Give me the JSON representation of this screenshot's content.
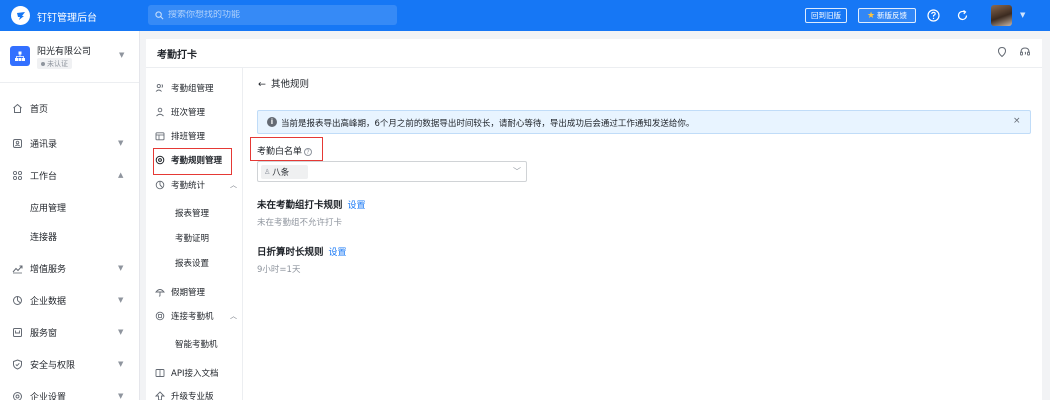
{
  "topbar": {
    "app_title": "钉钉管理后台",
    "search_placeholder": "搜索你想找的功能",
    "old_version_label": "回到旧版",
    "feedback_label": "新版反馈"
  },
  "org": {
    "name": "阳光有限公司",
    "status": "未认证"
  },
  "left_nav": {
    "home": "首页",
    "contacts": "通讯录",
    "workbench": "工作台",
    "app_manage": "应用管理",
    "connector": "连接器",
    "value_added": "增值服务",
    "enterprise_data": "企业数据",
    "service_window": "服务窗",
    "security": "安全与权限",
    "enterprise_settings": "企业设置"
  },
  "page": {
    "title": "考勤打卡"
  },
  "submenu": {
    "group_manage": "考勤组管理",
    "shift_manage": "班次管理",
    "schedule_manage": "排班管理",
    "rule_manage": "考勤规则管理",
    "statistics": "考勤统计",
    "report_manage": "报表管理",
    "attendance_proof": "考勤证明",
    "report_settings": "报表设置",
    "leave_manage": "假期管理",
    "connect_machine": "连接考勤机",
    "smart_machine": "智能考勤机",
    "api_docs": "API接入文档",
    "upgrade": "升级专业版"
  },
  "content": {
    "back_label": "其他规则",
    "alert_text": "当前是报表导出高峰期，6个月之前的数据导出时间较长，请耐心等待，导出成功后会通过工作通知发送给你。",
    "alert_close": "×",
    "whitelist_label": "考勤白名单",
    "whitelist_tag": "八条",
    "rule1_title": "未在考勤组打卡规则",
    "rule1_link": "设置",
    "rule1_desc": "未在考勤组不允许打卡",
    "rule2_title": "日折算时长规则",
    "rule2_link": "设置",
    "rule2_desc": "9小时=1天"
  }
}
